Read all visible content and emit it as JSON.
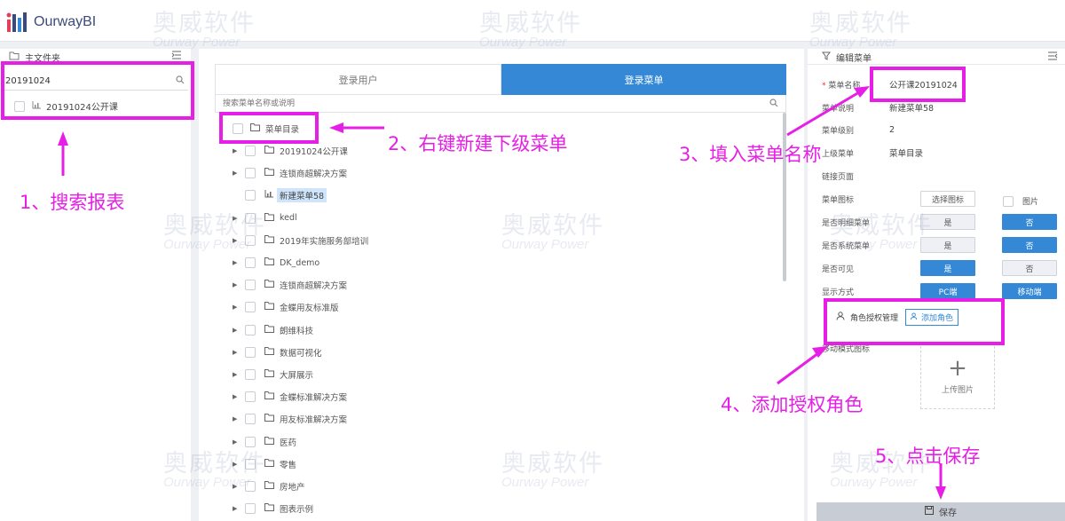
{
  "app": {
    "logo_text": "OurwayBI"
  },
  "watermark": {
    "cn": "奥威软件",
    "en": "Ourway Power"
  },
  "left_panel": {
    "title": "主文件夹",
    "search_value": "20191024",
    "result_label": "20191024公开课"
  },
  "center_panel": {
    "tabs": [
      {
        "label": "登录用户",
        "active": false
      },
      {
        "label": "登录菜单",
        "active": true
      }
    ],
    "search_placeholder": "搜索菜单名称或说明",
    "root_label": "菜单目录",
    "nodes": [
      {
        "label": "20191024公开课",
        "type": "folder"
      },
      {
        "label": "连锁商超解决方案",
        "type": "folder"
      },
      {
        "label": "新建菜单58",
        "type": "report",
        "selected": true
      },
      {
        "label": "kedl",
        "type": "folder"
      },
      {
        "label": "2019年实施服务部培训",
        "type": "folder"
      },
      {
        "label": "DK_demo",
        "type": "folder"
      },
      {
        "label": "连锁商超解决方案",
        "type": "folder"
      },
      {
        "label": "金蝶用友标准版",
        "type": "folder"
      },
      {
        "label": "朗维科技",
        "type": "folder"
      },
      {
        "label": "数据可视化",
        "type": "folder"
      },
      {
        "label": "大屏展示",
        "type": "folder"
      },
      {
        "label": "金蝶标准解决方案",
        "type": "folder"
      },
      {
        "label": "用友标准解决方案",
        "type": "folder"
      },
      {
        "label": "医药",
        "type": "folder"
      },
      {
        "label": "零售",
        "type": "folder"
      },
      {
        "label": "房地产",
        "type": "folder"
      },
      {
        "label": "图表示例",
        "type": "folder"
      }
    ]
  },
  "right_panel": {
    "title": "编辑菜单",
    "fields": {
      "menu_name_label": "菜单名称",
      "menu_name_value": "公开课20191024",
      "menu_desc_label": "菜单说明",
      "menu_desc_value": "新建菜单58",
      "menu_level_label": "菜单级别",
      "menu_level_value": "2",
      "parent_label": "上级菜单",
      "parent_value": "菜单目录",
      "link_label": "链接页面",
      "icon_label": "菜单图标",
      "choose_icon_button": "选择图标",
      "picture_checkbox": "图片",
      "detail_menu_label": "是否明细菜单",
      "system_menu_label": "是否系统菜单",
      "visible_label": "是否可见",
      "yes": "是",
      "no": "否",
      "display_label": "显示方式",
      "pc_button": "PC端",
      "mobile_button": "移动端",
      "role_label": "角色授权管理",
      "add_role_button": "添加角色",
      "mobile_icon_label": "移动模式图标",
      "upload_label": "上传图片",
      "save_button": "保存"
    }
  },
  "annotations": {
    "step1": "1、搜索报表",
    "step2": "2、右键新建下级菜单",
    "step3": "3、填入菜单名称",
    "step4": "4、添加授权角色",
    "step5": "5、点击保存",
    "color": "#e61ee6"
  }
}
